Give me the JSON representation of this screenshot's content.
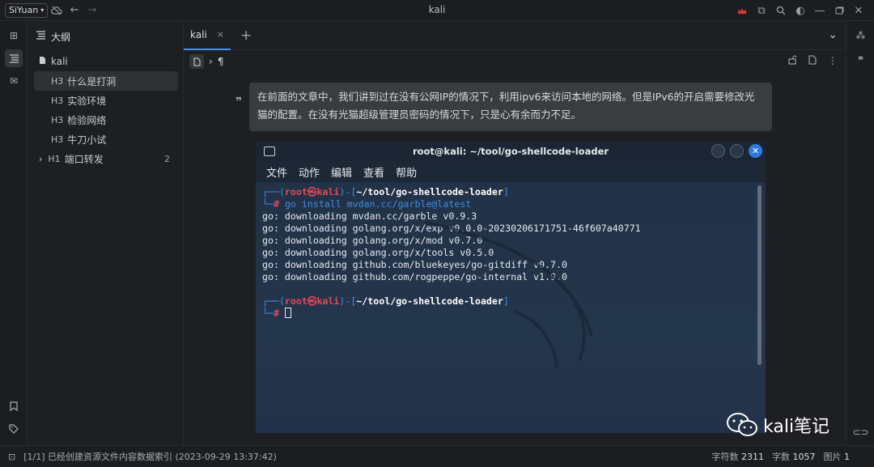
{
  "titlebar": {
    "brand": "SiYuan",
    "title": "kali"
  },
  "outline": {
    "header": "大纲",
    "doc": "kali",
    "items": [
      {
        "level": "H3",
        "label": "什么是打洞",
        "selected": true
      },
      {
        "level": "H3",
        "label": "实验环境"
      },
      {
        "level": "H3",
        "label": "检验网络"
      },
      {
        "level": "H3",
        "label": "牛刀小试"
      },
      {
        "level": "H1",
        "label": "端口转发",
        "count": "2"
      }
    ]
  },
  "editor": {
    "tab_label": "kali",
    "quote_text": "在前面的文章中，我们讲到过在没有公网IP的情况下，利用ipv6来访问本地的网络。但是IPv6的开启需要修改光猫的配置。在没有光猫超级管理员密码的情况下，只是心有余而力不足。"
  },
  "terminal": {
    "title": "root@kali: ~/tool/go-shellcode-loader",
    "menu": [
      "文件",
      "动作",
      "编辑",
      "查看",
      "帮助"
    ],
    "prompt_user": "root",
    "prompt_at": "㉿",
    "prompt_host": "kali",
    "prompt_path": "~/tool/go-shellcode-loader",
    "command": "go install mvdan.cc/garble@latest",
    "output": [
      "go: downloading mvdan.cc/garble v0.9.3",
      "go: downloading golang.org/x/exp v0.0.0-20230206171751-46f607a40771",
      "go: downloading golang.org/x/mod v0.7.0",
      "go: downloading golang.org/x/tools v0.5.0",
      "go: downloading github.com/bluekeyes/go-gitdiff v0.7.0",
      "go: downloading github.com/rogpeppe/go-internal v1.9.0"
    ]
  },
  "watermark": "kali笔记",
  "status": {
    "left": "[1/1] 已经创建资源文件内容数据索引 (2023-09-29 13:37:42)",
    "chars_label": "字符数",
    "chars": "2311",
    "words_label": "字数",
    "words": "1057",
    "images_label": "图片",
    "images": "1"
  },
  "colors": {
    "accent": "#4d8ef0",
    "prompt_blue": "#3d8de6",
    "prompt_red": "#e04b5a",
    "crown": "#d9383a"
  }
}
